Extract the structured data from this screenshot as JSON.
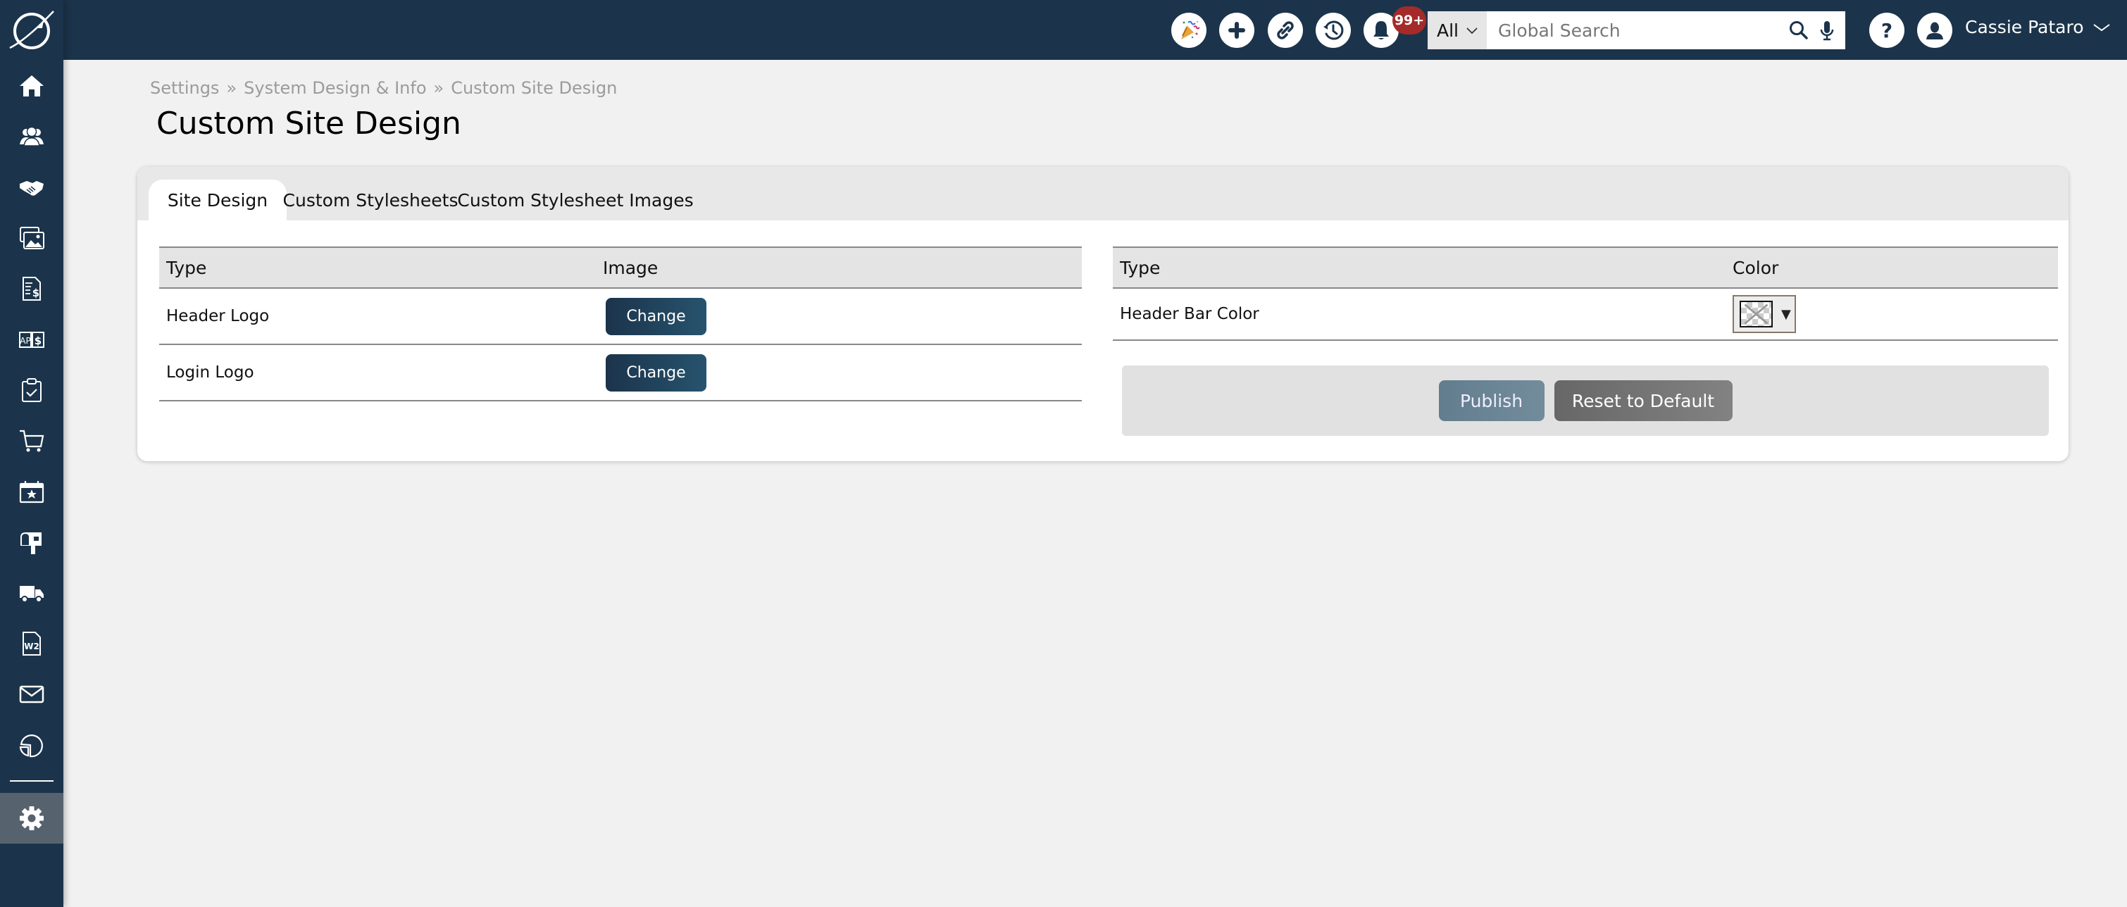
{
  "header": {
    "icons": [
      {
        "name": "celebration-icon",
        "label": "What's New"
      },
      {
        "name": "plus-icon",
        "label": "Add"
      },
      {
        "name": "link-icon",
        "label": "Links"
      },
      {
        "name": "history-icon",
        "label": "Recent"
      },
      {
        "name": "bell-icon",
        "label": "Notifications"
      }
    ],
    "notification_badge": "99+",
    "search": {
      "scope": "All",
      "placeholder": "Global Search",
      "value": ""
    },
    "user_name": "Cassie Pataro"
  },
  "sidebar": {
    "items": [
      {
        "name": "home",
        "icon": "home-icon"
      },
      {
        "name": "contacts",
        "icon": "people-icon"
      },
      {
        "name": "relationships",
        "icon": "handshake-icon"
      },
      {
        "name": "media",
        "icon": "images-icon"
      },
      {
        "name": "invoices",
        "icon": "invoice-icon"
      },
      {
        "name": "accounts-payable",
        "icon": "ap-icon"
      },
      {
        "name": "tasks",
        "icon": "clipboard-check-icon"
      },
      {
        "name": "store",
        "icon": "cart-icon"
      },
      {
        "name": "events",
        "icon": "calendar-star-icon"
      },
      {
        "name": "mail",
        "icon": "mailbox-icon"
      },
      {
        "name": "shipping",
        "icon": "truck-icon"
      },
      {
        "name": "w2",
        "icon": "w2-document-icon"
      },
      {
        "name": "messages",
        "icon": "envelope-icon"
      },
      {
        "name": "reports",
        "icon": "pie-chart-icon"
      }
    ],
    "active": "settings"
  },
  "breadcrumb": [
    "Settings",
    "System Design & Info",
    "Custom Site Design"
  ],
  "breadcrumb_separator": "»",
  "page_title": "Custom Site Design",
  "tabs": [
    {
      "label": "Site Design",
      "active": true
    },
    {
      "label": "Custom Stylesheets",
      "active": false
    },
    {
      "label": "Custom Stylesheet Images",
      "active": false
    }
  ],
  "image_table": {
    "columns": [
      "Type",
      "Image"
    ],
    "rows": [
      {
        "type": "Header Logo",
        "action": "Change"
      },
      {
        "type": "Login Logo",
        "action": "Change"
      }
    ]
  },
  "color_table": {
    "columns": [
      "Type",
      "Color"
    ],
    "rows": [
      {
        "type": "Header Bar Color",
        "value": "none"
      }
    ]
  },
  "actions": {
    "publish": "Publish",
    "reset": "Reset to Default"
  },
  "colors": {
    "nav_bg": "#1b344b",
    "badge": "#a52a2a",
    "page_bg": "#f1f1f1",
    "active_side": "#56636f"
  }
}
